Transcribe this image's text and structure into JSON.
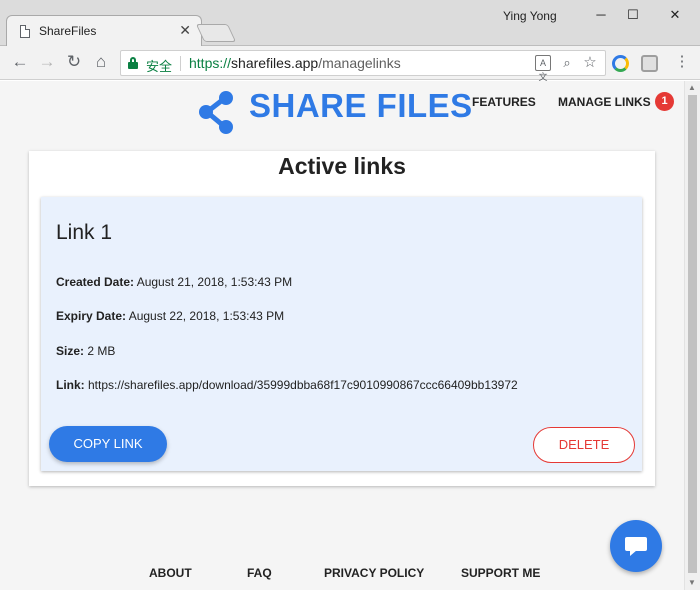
{
  "browser": {
    "tab_title": "ShareFiles",
    "user_name": "Ying Yong",
    "secure_label": "安全",
    "url_protocol": "https://",
    "url_host": "sharefiles.app",
    "url_path": "/managelinks"
  },
  "site": {
    "brand_name": "SHARE FILES",
    "brand_color": "#2f7ae5",
    "nav": {
      "features": "FEATURES",
      "manage_links": "MANAGE LINKS",
      "badge_count": "1"
    }
  },
  "main": {
    "title": "Active links",
    "links": [
      {
        "name": "Link 1",
        "created_label": "Created Date:",
        "created_value": " August 21, 2018, 1:53:43 PM",
        "expiry_label": "Expiry Date:",
        "expiry_value": " August 22, 2018, 1:53:43 PM",
        "size_label": "Size:",
        "size_value": " 2 MB",
        "link_label": "Link:",
        "link_value": " https://sharefiles.app/download/35999dbba68f17c9010990867ccc66409bb13972",
        "copy_label": "COPY LINK",
        "delete_label": "DELETE"
      }
    ]
  },
  "footer": {
    "about": "ABOUT",
    "faq": "FAQ",
    "privacy": "PRIVACY POLICY",
    "support": "SUPPORT ME"
  },
  "colors": {
    "primary": "#2f7ae5",
    "danger": "#e53935",
    "secure_green": "#0b8043"
  }
}
